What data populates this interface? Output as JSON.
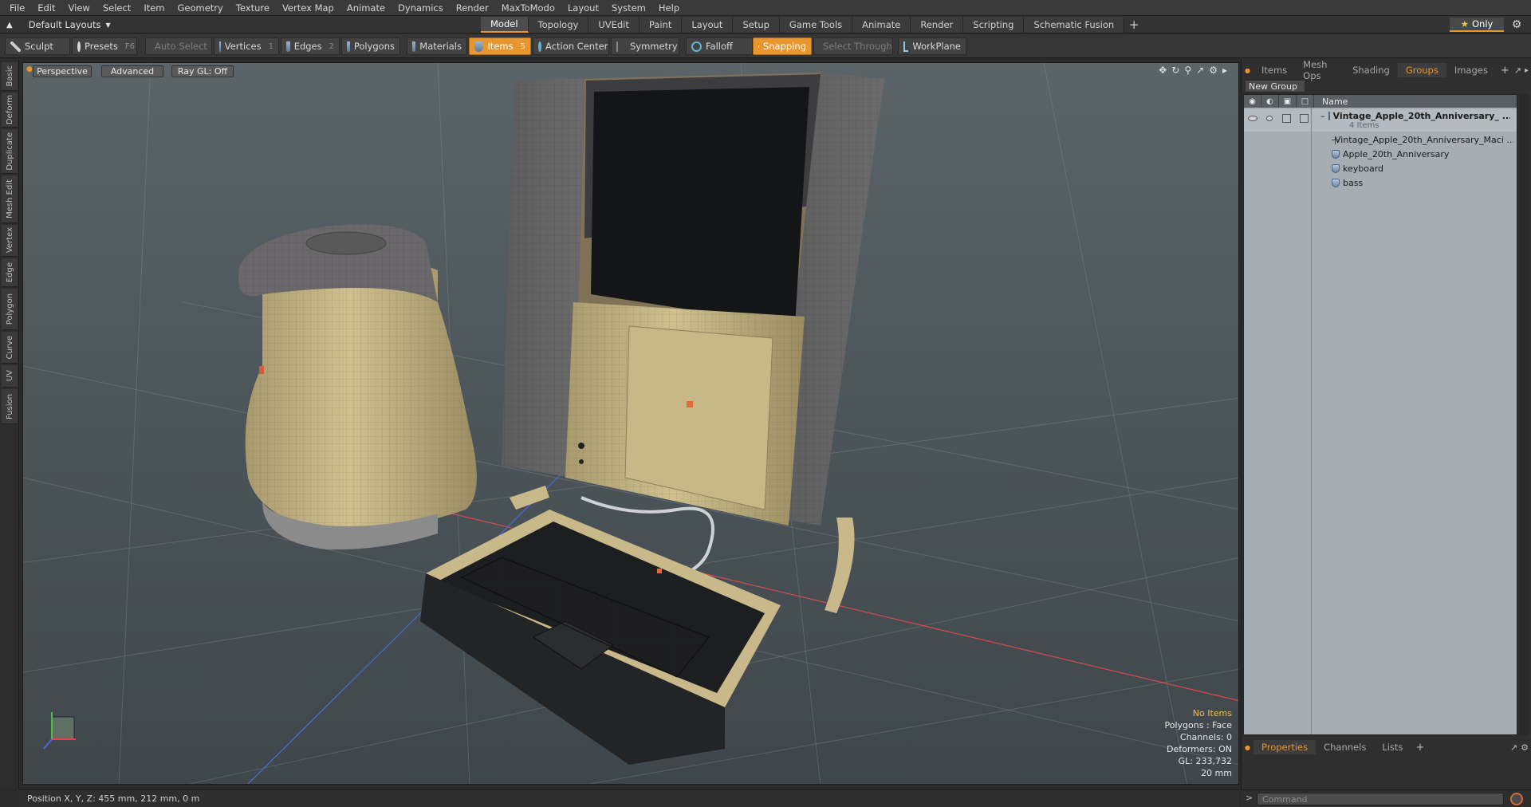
{
  "menu": [
    "File",
    "Edit",
    "View",
    "Select",
    "Item",
    "Geometry",
    "Texture",
    "Vertex Map",
    "Animate",
    "Dynamics",
    "Render",
    "MaxToModo",
    "Layout",
    "System",
    "Help"
  ],
  "layout": {
    "dropdown": "Default Layouts",
    "only": "Only"
  },
  "mode_tabs": [
    "Model",
    "Topology",
    "UVEdit",
    "Paint",
    "Layout",
    "Setup",
    "Game Tools",
    "Animate",
    "Render",
    "Scripting",
    "Schematic Fusion"
  ],
  "active_mode": "Model",
  "toolbar": {
    "sculpt": "Sculpt",
    "presets": "Presets",
    "presets_key": "F6",
    "auto_select": "Auto Select",
    "vertices": "Vertices",
    "vertices_key": "1",
    "edges": "Edges",
    "edges_key": "2",
    "polygons": "Polygons",
    "materials": "Materials",
    "items": "Items",
    "items_key": "5",
    "action_center": "Action Center",
    "symmetry": "Symmetry",
    "falloff": "Falloff",
    "snapping": "Snapping",
    "select_through": "Select Through",
    "workplane": "WorkPlane"
  },
  "left_tabs": [
    "Basic",
    "Deform",
    "Duplicate",
    "Mesh Edit",
    "Vertex",
    "Edge",
    "Polygon",
    "Curve",
    "UV",
    "Fusion"
  ],
  "viewport": {
    "view": "Perspective",
    "advanced": "Advanced",
    "raygl": "Ray GL: Off",
    "info": {
      "items": "No Items",
      "polygons": "Polygons : Face",
      "channels": "Channels: 0",
      "deformers": "Deformers: ON",
      "gl": "GL: 233,732",
      "unit": "20 mm"
    }
  },
  "status": {
    "position": "Position X, Y, Z:  455 mm, 212 mm, 0 m"
  },
  "right_panel": {
    "tabs": [
      "Items",
      "Mesh Ops",
      "Shading",
      "Groups",
      "Images"
    ],
    "active_tab": "Groups",
    "new_group": "New Group",
    "column_name": "Name",
    "group": {
      "name": "Vintage_Apple_20th_Anniversary_ ...",
      "count": "4 Items"
    },
    "children": [
      "Vintage_Apple_20th_Anniversary_Maci ...",
      "Apple_20th_Anniversary",
      "keyboard",
      "bass"
    ],
    "bottom_tabs": [
      "Properties",
      "Channels",
      "Lists"
    ],
    "active_bottom": "Properties",
    "command_placeholder": "Command"
  },
  "colors": {
    "accent": "#e8962e",
    "beige": "#c9b98a",
    "panel_bg": "#a6adb3"
  }
}
